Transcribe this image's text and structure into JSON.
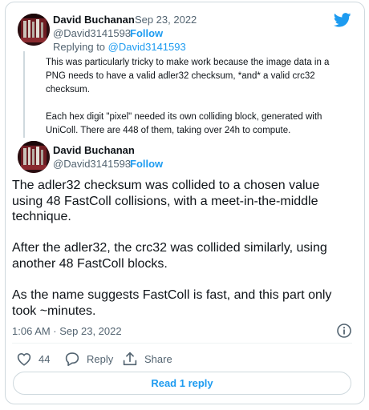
{
  "reply_tweet": {
    "author_name": "David Buchanan",
    "date": "· Sep 23, 2022",
    "handle": "@David3141593",
    "separator": "·",
    "follow_label": "Follow",
    "replying_prefix": "Replying to",
    "replying_handle": "@David3141593",
    "text": "This was particularly tricky to make work because the image data in a\nPNG needs to have a valid adler32 checksum, *and* a valid crc32\nchecksum.\n\nEach hex digit \"pixel\" needed its own colliding block, generated with\nUniColl. There are 448 of them, taking over 24h to compute."
  },
  "main_tweet": {
    "author_name": "David Buchanan",
    "handle": "@David3141593",
    "separator": "·",
    "follow_label": "Follow",
    "text": "The adler32 checksum was collided to a chosen value\nusing 48 FastColl collisions, with a meet-in-the-middle\ntechnique.\n\nAfter the adler32, the crc32 was collided similarly, using\nanother 48 FastColl blocks.\n\nAs the name suggests FastColl is fast, and this part only\ntook ~minutes.",
    "timestamp": "1:06 AM · Sep 23, 2022"
  },
  "actions": {
    "like_count": "44",
    "reply_label": "Reply",
    "share_label": "Share"
  },
  "read_reply_label": "Read 1 reply",
  "icons": {
    "brand": "twitter-bird-icon",
    "info": "info-icon",
    "like": "heart-icon",
    "reply": "speech-bubble-icon",
    "share": "share-icon"
  },
  "colors": {
    "accent": "#1d9bf0",
    "secondary_text": "#536471",
    "border": "#cfd9de"
  }
}
